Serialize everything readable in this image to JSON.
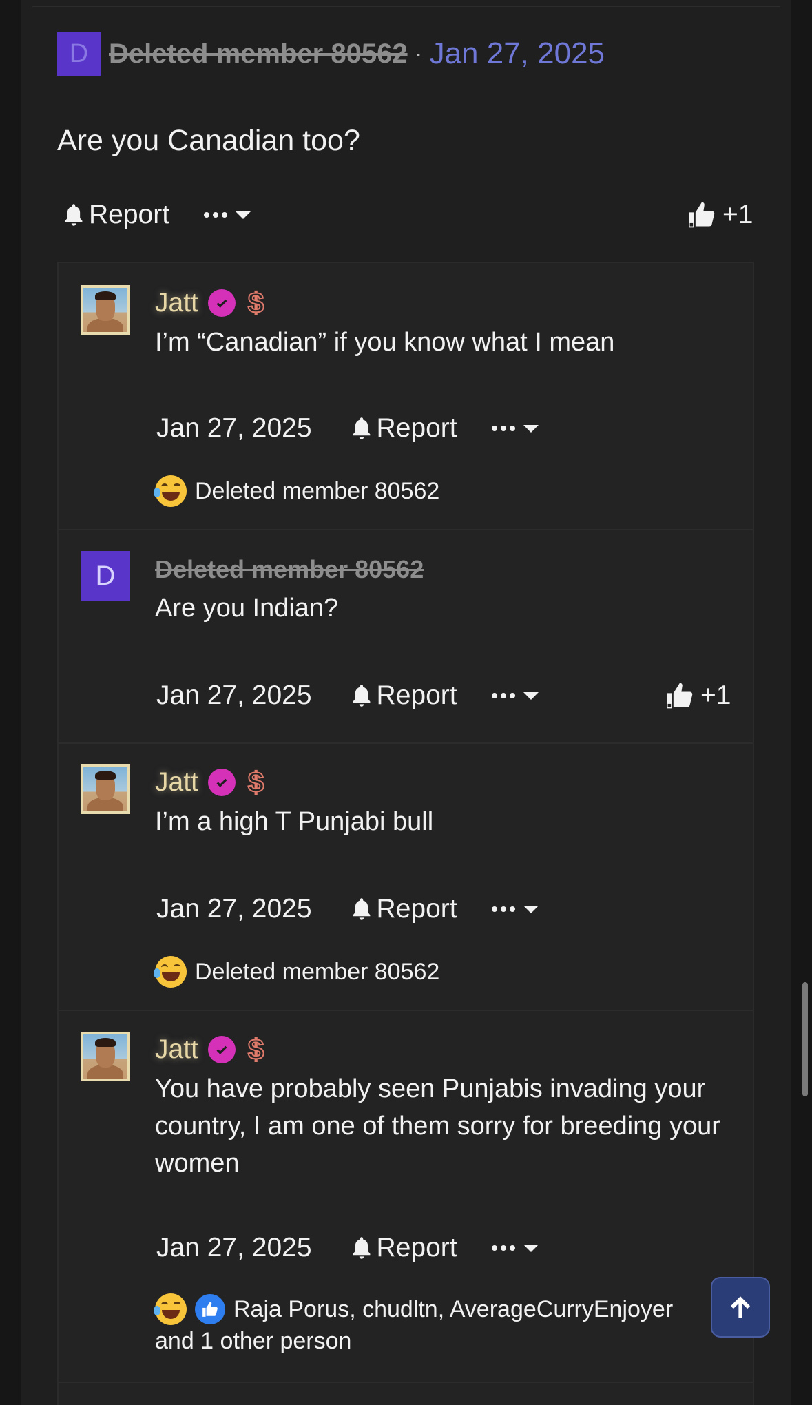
{
  "post": {
    "avatar_letter": "D",
    "author": "Deleted member 80562",
    "separator": "·",
    "date": "Jan 27, 2025",
    "body": "Are you Canadian too?",
    "report_label": "Report",
    "like_count": "+1"
  },
  "replies": [
    {
      "author": "Jatt",
      "dollar": "$",
      "body": "I’m “Canadian” if you know what I mean",
      "date": "Jan 27, 2025",
      "report_label": "Report",
      "reactions_text": "Deleted member 80562"
    },
    {
      "avatar_letter": "D",
      "author": "Deleted member 80562",
      "body": "Are you Indian?",
      "date": "Jan 27, 2025",
      "report_label": "Report",
      "like_count": "+1"
    },
    {
      "author": "Jatt",
      "dollar": "$",
      "body": "I’m a high T Punjabi bull",
      "date": "Jan 27, 2025",
      "report_label": "Report",
      "reactions_text": "Deleted member 80562"
    },
    {
      "author": "Jatt",
      "dollar": "$",
      "body": "You have probably seen Punjabis invading your country, I am one of them sorry for breeding your women",
      "date": "Jan 27, 2025",
      "report_label": "Report",
      "reactions_line1": "Raja Porus, chudltn, AverageCurryEnjoyer",
      "reactions_line2": "and 1 other person"
    }
  ],
  "colors": {
    "background": "#1f1f20",
    "accent_date": "#6f78d6",
    "verified_badge": "#d431b8",
    "username_gold": "#e8d7a6",
    "fab": "#2b3d76"
  },
  "icons": [
    "bell-icon",
    "more-dots-icon",
    "caret-down-icon",
    "thumbs-up-icon",
    "verified-check-icon",
    "dollar-icon",
    "laughing-emoji-icon",
    "like-emoji-icon",
    "arrow-up-icon"
  ]
}
